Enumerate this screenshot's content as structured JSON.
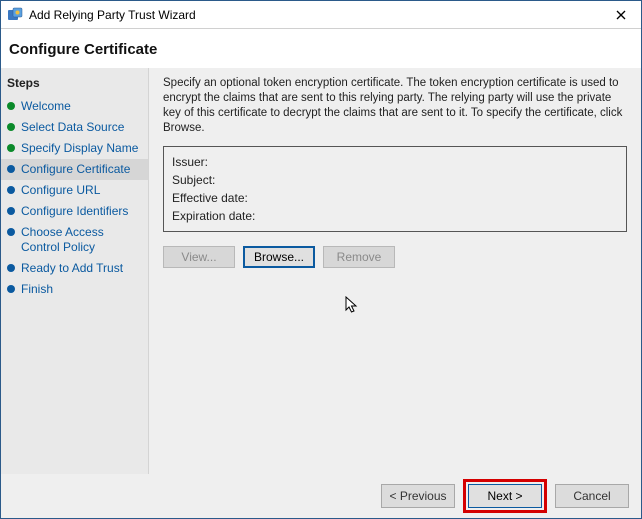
{
  "window": {
    "title": "Add Relying Party Trust Wizard",
    "subtitle": "Configure Certificate"
  },
  "sidebar": {
    "header": "Steps",
    "items": [
      {
        "label": "Welcome",
        "state": "done"
      },
      {
        "label": "Select Data Source",
        "state": "done"
      },
      {
        "label": "Specify Display Name",
        "state": "done"
      },
      {
        "label": "Configure Certificate",
        "state": "current"
      },
      {
        "label": "Configure URL",
        "state": "future"
      },
      {
        "label": "Configure Identifiers",
        "state": "future"
      },
      {
        "label": "Choose Access Control Policy",
        "state": "future"
      },
      {
        "label": "Ready to Add Trust",
        "state": "future"
      },
      {
        "label": "Finish",
        "state": "future"
      }
    ]
  },
  "main": {
    "instructions": "Specify an optional token encryption certificate.  The token encryption certificate is used to encrypt the claims that are sent to this relying party.  The relying party will use the private key of this certificate to decrypt the claims that are sent to it.  To specify the certificate, click Browse.",
    "cert": {
      "issuer_label": "Issuer:",
      "subject_label": "Subject:",
      "effective_label": "Effective date:",
      "expiration_label": "Expiration date:",
      "issuer": "",
      "subject": "",
      "effective": "",
      "expiration": ""
    },
    "buttons": {
      "view": "View...",
      "browse": "Browse...",
      "remove": "Remove"
    }
  },
  "footer": {
    "previous": "< Previous",
    "next": "Next >",
    "cancel": "Cancel"
  }
}
